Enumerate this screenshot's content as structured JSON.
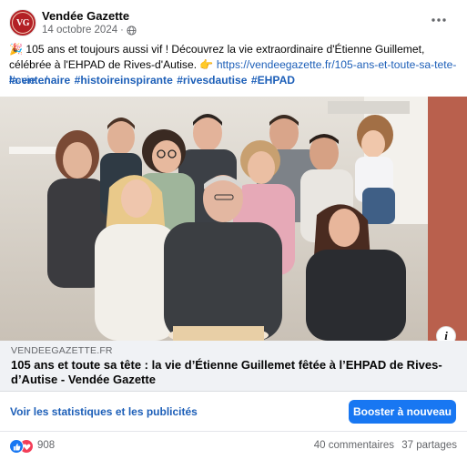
{
  "post": {
    "page_name": "Vendée Gazette",
    "avatar_initials": "VG",
    "date": "14 octobre 2024",
    "date_sep": "·",
    "text_prefix": "🎉 105 ans et toujours aussi vif ! Découvrez la vie extraordinaire d'Étienne Guillemet, célébrée à l'EHPAD de Rives-d'Autise. 👉 ",
    "text_link": "https://vendeegazette.fr/105-ans-et-toute-sa-tete-la-vie...",
    "text_suffix": "/",
    "hashtags": [
      "#centenaire",
      "#histoireinspirante",
      "#rivesdautise",
      " #EHPAD"
    ]
  },
  "link_preview": {
    "domain": "VENDEEGAZETTE.FR",
    "title": "105 ans et toute sa tête : la vie d’Étienne Guillemet fêtée à l’EHPAD de Rives-d’Autise - Vendée Gazette"
  },
  "actions": {
    "stats_label": "Voir les statistiques et les publicités",
    "boost_label": "Booster à nouveau"
  },
  "engagement": {
    "reaction_count": "908",
    "comments": "40 commentaires",
    "shares": "37 partages"
  },
  "colors": {
    "accent": "#1877f2",
    "link": "#1d5fb8",
    "brand_red": "#b32025",
    "love": "#f33e58"
  },
  "icons": {
    "privacy": "globe-icon",
    "more": "more-dots-icon",
    "info": "info-icon",
    "like": "like-icon",
    "love": "love-icon"
  }
}
